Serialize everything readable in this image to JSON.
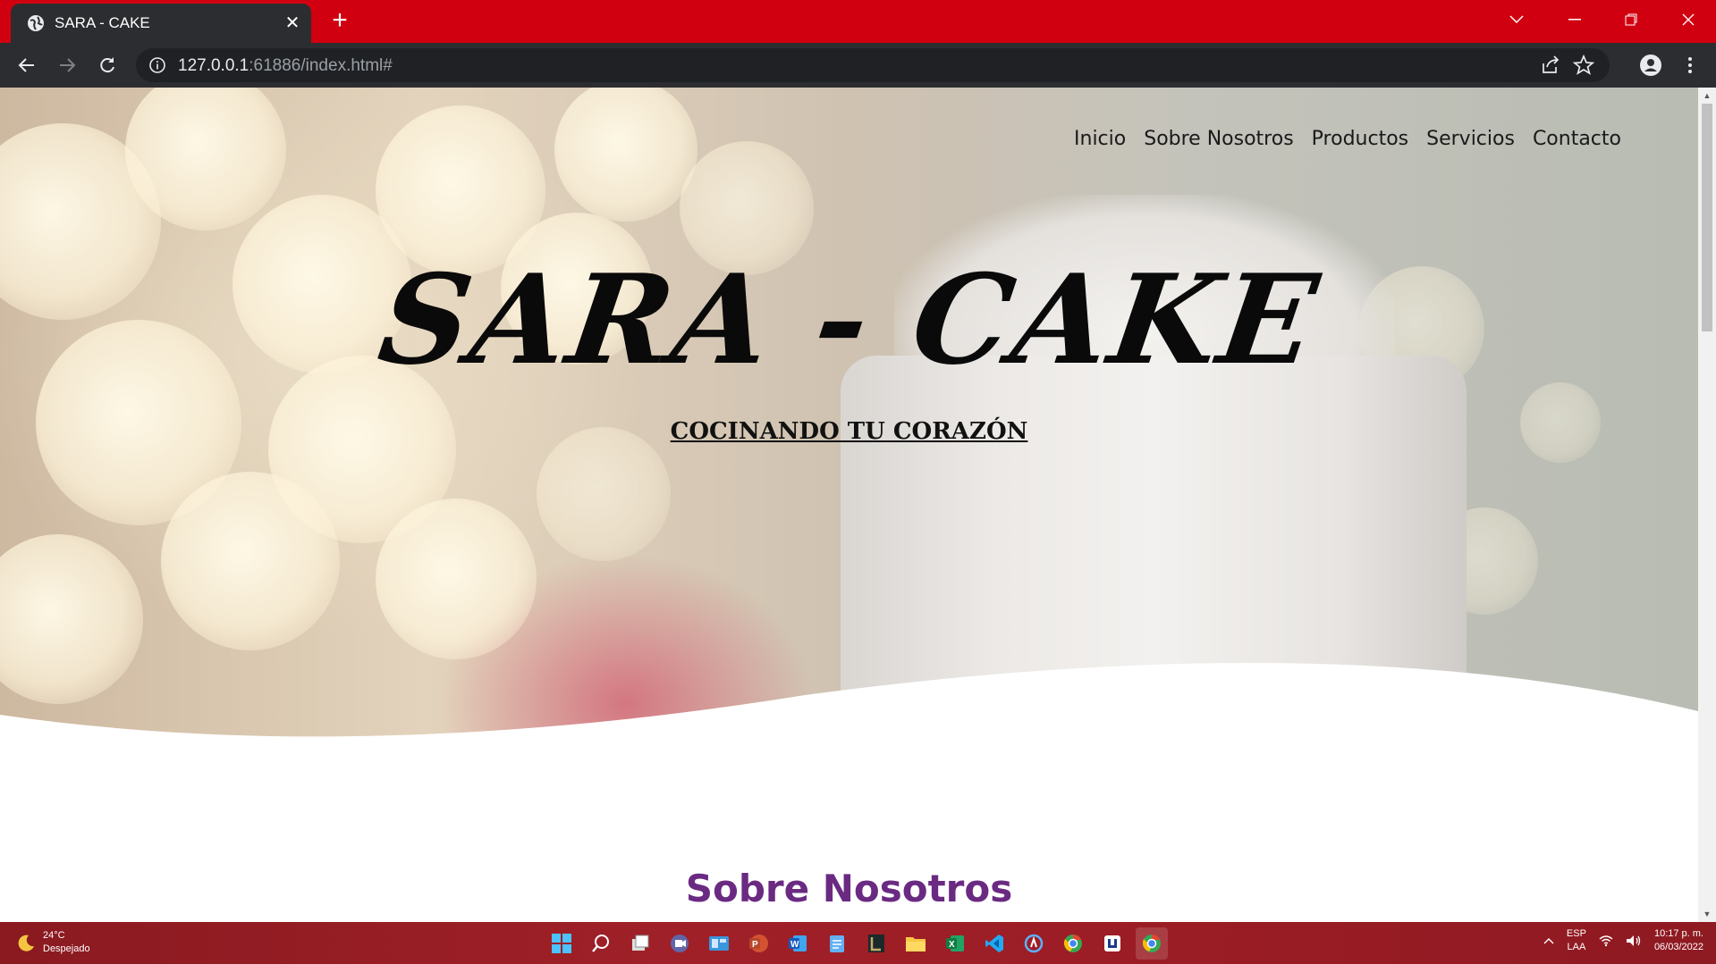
{
  "browser": {
    "tab_title": "SARA - CAKE",
    "new_tab_label": "+",
    "close_tab_label": "✕",
    "url_host": "127.0.0.1",
    "url_rest": ":61886/index.html#"
  },
  "site": {
    "nav": [
      "Inicio",
      "Sobre Nosotros",
      "Productos",
      "Servicios",
      "Contacto"
    ],
    "brand": "SARA - CAKE",
    "tagline": "COCINANDO TU CORAZÓN",
    "section_title": "Sobre Nosotros",
    "colors": {
      "accent": "#6a2a82",
      "tabstrip": "#d10010"
    }
  },
  "taskbar": {
    "weather_temp": "24°C",
    "weather_desc": "Despejado",
    "lang_top": "ESP",
    "lang_bottom": "LAA",
    "time": "10:17 p. m.",
    "date": "06/03/2022",
    "apps": [
      "start-icon",
      "search-icon",
      "task-view-icon",
      "teams-icon",
      "widgets-icon",
      "powerpoint-icon",
      "word-icon",
      "notepad-icon",
      "league-icon",
      "explorer-icon",
      "excel-icon",
      "vscode-icon",
      "azure-data-icon",
      "chrome-profile-icon",
      "app-icon",
      "chrome-icon"
    ]
  }
}
